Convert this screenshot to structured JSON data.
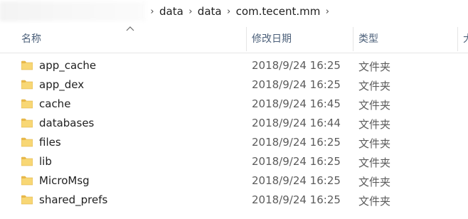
{
  "breadcrumb": {
    "items": [
      "data",
      "data",
      "com.tecent.mm"
    ]
  },
  "columns": {
    "name": "名称",
    "date_modified": "修改日期",
    "type": "类型",
    "size_partial": "大"
  },
  "files": [
    {
      "name": "app_cache",
      "date": "2018/9/24 16:25",
      "type": "文件夹"
    },
    {
      "name": "app_dex",
      "date": "2018/9/24 16:25",
      "type": "文件夹"
    },
    {
      "name": "cache",
      "date": "2018/9/24 16:45",
      "type": "文件夹"
    },
    {
      "name": "databases",
      "date": "2018/9/24 16:44",
      "type": "文件夹"
    },
    {
      "name": "files",
      "date": "2018/9/24 16:25",
      "type": "文件夹"
    },
    {
      "name": "lib",
      "date": "2018/9/24 16:25",
      "type": "文件夹"
    },
    {
      "name": "MicroMsg",
      "date": "2018/9/24 16:25",
      "type": "文件夹"
    },
    {
      "name": "shared_prefs",
      "date": "2018/9/24 16:25",
      "type": "文件夹"
    }
  ],
  "colors": {
    "folder_fill": "#f8d775",
    "folder_tab": "#e8b84a",
    "header_text": "#4c607a"
  },
  "icons": {
    "folder": "folder-icon",
    "separator": "chevron-right-icon",
    "sort": "sort-ascending-icon"
  }
}
